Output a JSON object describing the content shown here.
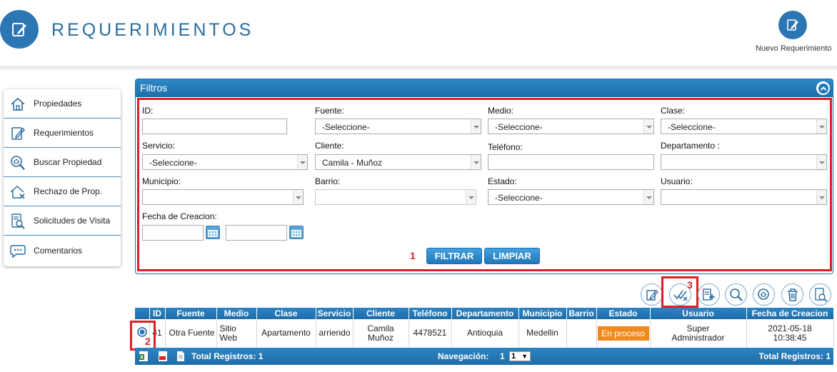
{
  "header": {
    "title": "REQUERIMIENTOS",
    "new_requirement_label": "Nuevo Requerimiento"
  },
  "sidebar": {
    "items": [
      {
        "label": "Propiedades",
        "icon": "home-icon"
      },
      {
        "label": "Requerimientos",
        "icon": "edit-icon"
      },
      {
        "label": "Buscar Propiedad",
        "icon": "search-home-icon"
      },
      {
        "label": "Rechazo de Prop.",
        "icon": "home-reject-icon"
      },
      {
        "label": "Solicitudes de Visita",
        "icon": "document-search-icon"
      },
      {
        "label": "Comentarios",
        "icon": "chat-bubble-icon"
      }
    ]
  },
  "filters": {
    "title": "Filtros",
    "id_label": "ID:",
    "id_value": "",
    "fuente_label": "Fuente:",
    "fuente_value": "-Seleccione-",
    "medio_label": "Medio:",
    "medio_value": "-Seleccione-",
    "clase_label": "Clase:",
    "clase_value": "-Seleccione-",
    "servicio_label": "Servicio:",
    "servicio_value": "-Seleccione-",
    "cliente_label": "Cliente:",
    "cliente_value": "Camila - Muñoz",
    "telefono_label": "Teléfono:",
    "telefono_value": "",
    "departamento_label": "Departamento :",
    "departamento_value": "",
    "municipio_label": "Municipio:",
    "municipio_value": "",
    "barrio_label": "Barrio:",
    "barrio_value": "",
    "estado_label": "Estado:",
    "estado_value": "-Seleccione-",
    "usuario_label": "Usuario:",
    "usuario_value": "",
    "fecha_label": "Fecha de Creacion:",
    "filter_button": "FILTRAR",
    "clear_button": "LIMPIAR"
  },
  "annotations": {
    "marker1": "1",
    "marker2": "2",
    "marker3": "3"
  },
  "toolbar": {
    "buttons": [
      "edit-icon",
      "approve-reject-icon",
      "add-record-icon",
      "search-icon",
      "search-home-icon",
      "trash-icon",
      "document-search-icon"
    ]
  },
  "table": {
    "headers": [
      "",
      "ID",
      "Fuente",
      "Medio",
      "Clase",
      "Servicio",
      "Cliente",
      "Teléfono",
      "Departamento",
      "Municipio",
      "Barrio",
      "Estado",
      "Usuario",
      "Fecha de Creacion"
    ],
    "rows": [
      {
        "selected": true,
        "id": "41",
        "fuente": "Otra Fuente",
        "medio": "Sitio Web",
        "clase": "Apartamento",
        "servicio": "arriendo",
        "cliente": "Camila Muñoz",
        "telefono": "4478521",
        "departamento": "Antioquia",
        "municipio": "Medellin",
        "barrio": "",
        "estado": "En proceso",
        "usuario": "Super Administrador",
        "fecha": "2021-05-18 10:38:45"
      }
    ]
  },
  "footer": {
    "total_left": "Total Registros: 1",
    "nav_label": "Navegación:",
    "nav_page": "1",
    "nav_select": "1",
    "total_right": "Total Registros: 1"
  },
  "colors": {
    "primary": "#1d6da8",
    "accent_red": "#dd1f26",
    "status_orange": "#f08a1e"
  }
}
